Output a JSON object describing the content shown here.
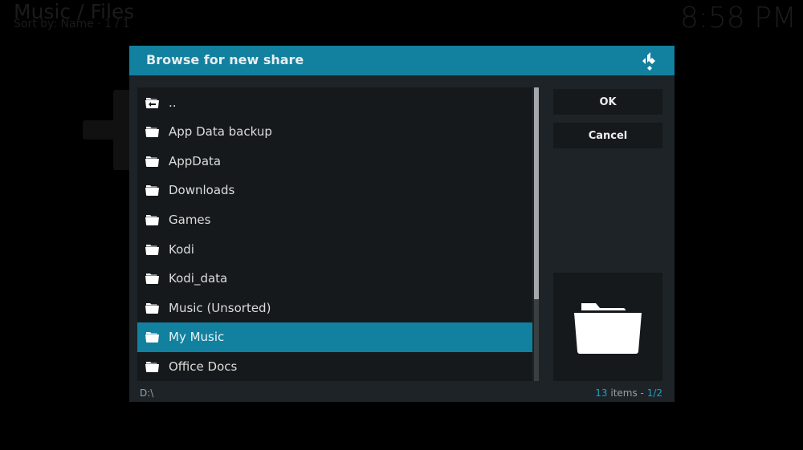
{
  "background": {
    "title": "Music / Files",
    "sort_info": "Sort by: Name  ·  1 / 1",
    "clock": "8:58 PM"
  },
  "dialog": {
    "title": "Browse for new share",
    "logo_icon": "kodi-logo-icon",
    "items": [
      {
        "label": "..",
        "icon": "folder-back-icon",
        "selected": false
      },
      {
        "label": "App Data backup",
        "icon": "folder-icon",
        "selected": false
      },
      {
        "label": "AppData",
        "icon": "folder-icon",
        "selected": false
      },
      {
        "label": "Downloads",
        "icon": "folder-icon",
        "selected": false
      },
      {
        "label": "Games",
        "icon": "folder-icon",
        "selected": false
      },
      {
        "label": "Kodi",
        "icon": "folder-icon",
        "selected": false
      },
      {
        "label": "Kodi_data",
        "icon": "folder-icon",
        "selected": false
      },
      {
        "label": "Music (Unsorted)",
        "icon": "folder-icon",
        "selected": false
      },
      {
        "label": "My Music",
        "icon": "folder-icon",
        "selected": true
      },
      {
        "label": "Office Docs",
        "icon": "folder-icon",
        "selected": false
      }
    ],
    "scroll_position_fraction": 0.0,
    "scroll_visible_fraction": 0.72,
    "buttons": {
      "ok": "OK",
      "cancel": "Cancel"
    },
    "preview_icon": "folder-icon",
    "current_path": "D:\\",
    "item_count": "13",
    "item_count_label": " items - ",
    "page": "1/2",
    "accent_color": "#12809f"
  }
}
